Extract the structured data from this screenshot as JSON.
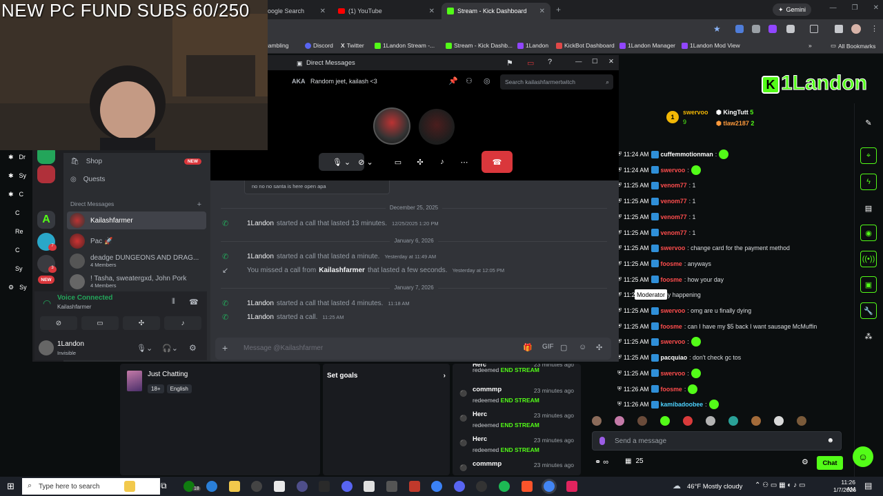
{
  "browser": {
    "tabs": [
      {
        "label": "oogle Search",
        "active": false
      },
      {
        "label": "(1) YouTube",
        "active": false
      },
      {
        "label": "Stream - Kick Dashboard",
        "active": true
      }
    ],
    "gemini_label": "Gemini",
    "bookmarks": [
      "gambling",
      "Discord",
      "Twitter",
      "1Landon Stream -...",
      "Stream - Kick Dashb...",
      "1Landon",
      "KickBot Dashboard",
      "1Landon Manager",
      "1Landon Mod View"
    ],
    "more_bookmarks": "»",
    "all_bookmarks": "All Bookmarks"
  },
  "webcam": {
    "overlay_text": "NEW PC FUND SUBS 60/250"
  },
  "discord": {
    "window_title": "Direct Messages",
    "header": {
      "name_fragment": "ner",
      "aka_label": "AKA",
      "aka_value": "Random jeet, kailash <3",
      "search_placeholder": "Search kailashfarmertwitch"
    },
    "sidebar": {
      "shop_label": "Shop",
      "shop_badge": "NEW",
      "quests_label": "Quests",
      "dm_header": "Direct Messages",
      "dms": [
        {
          "name": "Kailashfarmer",
          "sub": "",
          "selected": true
        },
        {
          "name": "Pac 🚀",
          "sub": "",
          "selected": false
        },
        {
          "name": "deadge DUNGEONS AND DRAG...",
          "sub": "4 Members",
          "selected": false
        },
        {
          "name": "! Tasha, sweatergxd, John Pork",
          "sub": "4 Members",
          "selected": false
        }
      ],
      "voice_status": "Voice Connected",
      "voice_channel": "Kailashfarmer",
      "user_name": "1Landon",
      "user_status": "Invisible"
    },
    "servers": {
      "new_badge": "NEW",
      "ping_count": "7",
      "ping_count2": "3"
    },
    "left_partial_labels": [
      "Dr",
      "Sy",
      "C",
      "C",
      "Re",
      "C",
      "Sy",
      "Sy"
    ],
    "pinned_snippet": "no no no santa is here open apa",
    "messages": [
      {
        "type": "date",
        "text": "December 25, 2025"
      },
      {
        "type": "call",
        "who": "1Landon",
        "text": "started a call that lasted 13 minutes.",
        "ts": "12/25/2025 1:20 PM"
      },
      {
        "type": "date",
        "text": "January 6, 2026"
      },
      {
        "type": "call",
        "who": "1Landon",
        "text": "started a call that lasted a minute.",
        "ts": "Yesterday at 11:49 AM"
      },
      {
        "type": "missed",
        "pre": "You missed a call from",
        "who": "Kailashfarmer",
        "text": "that lasted a few seconds.",
        "ts": "Yesterday at 12:05 PM"
      },
      {
        "type": "date",
        "text": "January 7, 2026"
      },
      {
        "type": "call",
        "who": "1Landon",
        "text": "started a call that lasted 4 minutes.",
        "ts": "11:18 AM"
      },
      {
        "type": "call",
        "who": "1Landon",
        "text": "started a call.",
        "ts": "11:25 AM"
      }
    ],
    "message_placeholder": "Message @Kailashfarmer"
  },
  "kick": {
    "logo_text": "1Landon",
    "leaderboard": [
      {
        "name": "swervoo",
        "value": "9"
      },
      {
        "name": "KingTutt",
        "value": "5"
      },
      {
        "name": "tlaw2187",
        "value": "2"
      }
    ],
    "category": {
      "name": "Just Chatting",
      "tags": [
        "18+",
        "English"
      ]
    },
    "set_goals_label": "Set goals",
    "activity": [
      {
        "name": "Herc",
        "ago": "23 minutes ago",
        "pre": "redeemed",
        "item": "END STREAM"
      },
      {
        "name": "commmp",
        "ago": "23 minutes ago",
        "pre": "redeemed",
        "item": "END STREAM"
      },
      {
        "name": "Herc",
        "ago": "23 minutes ago",
        "pre": "redeemed",
        "item": "END STREAM"
      },
      {
        "name": "Herc",
        "ago": "23 minutes ago",
        "pre": "redeemed",
        "item": "END STREAM"
      },
      {
        "name": "commmp",
        "ago": "23 minutes ago",
        "pre": "",
        "item": ""
      }
    ],
    "chat": [
      {
        "time": "11:24 AM",
        "user": "cuffemmotionman",
        "color": "#ffffff",
        "text": ":",
        "emote": true
      },
      {
        "time": "11:24 AM",
        "user": "swervoo",
        "color": "#ff4d4d",
        "text": ":",
        "emote": true
      },
      {
        "time": "11:25 AM",
        "user": "venom77",
        "color": "#ff4d4d",
        "text": ": 1",
        "emote": false
      },
      {
        "time": "11:25 AM",
        "user": "venom77",
        "color": "#ff4d4d",
        "text": ": 1",
        "emote": false
      },
      {
        "time": "11:25 AM",
        "user": "venom77",
        "color": "#ff4d4d",
        "text": ": 1",
        "emote": false
      },
      {
        "time": "11:25 AM",
        "user": "venom77",
        "color": "#ff4d4d",
        "text": ": 1",
        "emote": false
      },
      {
        "time": "11:25 AM",
        "user": "swervoo",
        "color": "#ff4d4d",
        "text": ": change card for the payment method",
        "emote": false
      },
      {
        "time": "11:25 AM",
        "user": "foosme",
        "color": "#ff4d4d",
        "text": ": anyways",
        "emote": false
      },
      {
        "time": "11:25 AM",
        "user": "foosme",
        "color": "#ff4d4d",
        "text": ": how your day",
        "emote": false
      },
      {
        "time": "11:2",
        "user": "",
        "color": "#ffffff",
        "text": "ts finally happening",
        "emote": false
      },
      {
        "time": "11:25 AM",
        "user": "swervoo",
        "color": "#ff4d4d",
        "text": ": omg are u finally dying",
        "emote": false
      },
      {
        "time": "11:25 AM",
        "user": "foosme",
        "color": "#ff4d4d",
        "text": ": can I have my $5 back I want sausage McMuffin",
        "emote": false
      },
      {
        "time": "11:25 AM",
        "user": "swervoo",
        "color": "#ff4d4d",
        "text": ":",
        "emote": true
      },
      {
        "time": "11:25 AM",
        "user": "pacquiao",
        "color": "#ffffff",
        "text": ": don't check gc tos",
        "emote": false
      },
      {
        "time": "11:25 AM",
        "user": "swervoo",
        "color": "#ff4d4d",
        "text": ":",
        "emote": true
      },
      {
        "time": "11:26 AM",
        "user": "foosme",
        "color": "#ff4d4d",
        "text": ":",
        "emote": true
      },
      {
        "time": "11:26 AM",
        "user": "kamibadoobee",
        "color": "#4dd2ff",
        "text": ":",
        "emote": true
      }
    ],
    "tooltip": "Moderator",
    "chat_placeholder": "Send a message",
    "viewer_count": "25",
    "chat_button": "Chat"
  },
  "taskbar": {
    "search_placeholder": "Type here to search",
    "badge_count": "18",
    "weather": "46°F  Mostly cloudy",
    "time": "11:26 AM",
    "date": "1/7/2026"
  },
  "colors": {
    "kick_green": "#53fc18",
    "discord_bg": "#313338",
    "hangup_red": "#da373c"
  }
}
